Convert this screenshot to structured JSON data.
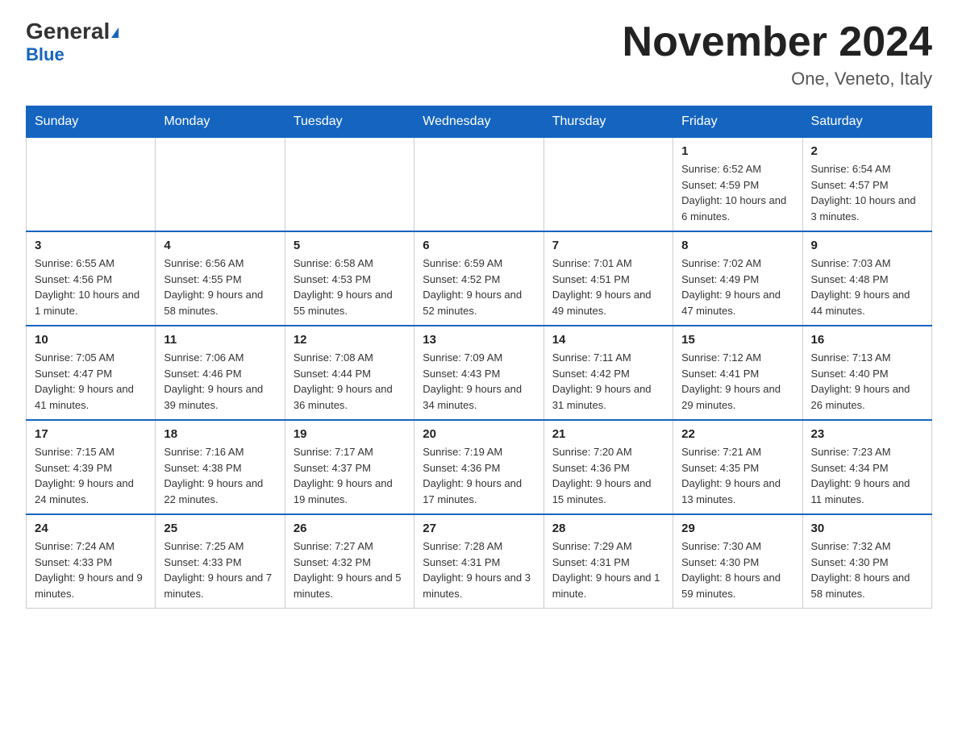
{
  "header": {
    "logo_general": "General",
    "logo_blue": "Blue",
    "month_title": "November 2024",
    "location": "One, Veneto, Italy"
  },
  "weekdays": [
    "Sunday",
    "Monday",
    "Tuesday",
    "Wednesday",
    "Thursday",
    "Friday",
    "Saturday"
  ],
  "weeks": [
    [
      {
        "day": "",
        "info": ""
      },
      {
        "day": "",
        "info": ""
      },
      {
        "day": "",
        "info": ""
      },
      {
        "day": "",
        "info": ""
      },
      {
        "day": "",
        "info": ""
      },
      {
        "day": "1",
        "info": "Sunrise: 6:52 AM\nSunset: 4:59 PM\nDaylight: 10 hours and 6 minutes."
      },
      {
        "day": "2",
        "info": "Sunrise: 6:54 AM\nSunset: 4:57 PM\nDaylight: 10 hours and 3 minutes."
      }
    ],
    [
      {
        "day": "3",
        "info": "Sunrise: 6:55 AM\nSunset: 4:56 PM\nDaylight: 10 hours and 1 minute."
      },
      {
        "day": "4",
        "info": "Sunrise: 6:56 AM\nSunset: 4:55 PM\nDaylight: 9 hours and 58 minutes."
      },
      {
        "day": "5",
        "info": "Sunrise: 6:58 AM\nSunset: 4:53 PM\nDaylight: 9 hours and 55 minutes."
      },
      {
        "day": "6",
        "info": "Sunrise: 6:59 AM\nSunset: 4:52 PM\nDaylight: 9 hours and 52 minutes."
      },
      {
        "day": "7",
        "info": "Sunrise: 7:01 AM\nSunset: 4:51 PM\nDaylight: 9 hours and 49 minutes."
      },
      {
        "day": "8",
        "info": "Sunrise: 7:02 AM\nSunset: 4:49 PM\nDaylight: 9 hours and 47 minutes."
      },
      {
        "day": "9",
        "info": "Sunrise: 7:03 AM\nSunset: 4:48 PM\nDaylight: 9 hours and 44 minutes."
      }
    ],
    [
      {
        "day": "10",
        "info": "Sunrise: 7:05 AM\nSunset: 4:47 PM\nDaylight: 9 hours and 41 minutes."
      },
      {
        "day": "11",
        "info": "Sunrise: 7:06 AM\nSunset: 4:46 PM\nDaylight: 9 hours and 39 minutes."
      },
      {
        "day": "12",
        "info": "Sunrise: 7:08 AM\nSunset: 4:44 PM\nDaylight: 9 hours and 36 minutes."
      },
      {
        "day": "13",
        "info": "Sunrise: 7:09 AM\nSunset: 4:43 PM\nDaylight: 9 hours and 34 minutes."
      },
      {
        "day": "14",
        "info": "Sunrise: 7:11 AM\nSunset: 4:42 PM\nDaylight: 9 hours and 31 minutes."
      },
      {
        "day": "15",
        "info": "Sunrise: 7:12 AM\nSunset: 4:41 PM\nDaylight: 9 hours and 29 minutes."
      },
      {
        "day": "16",
        "info": "Sunrise: 7:13 AM\nSunset: 4:40 PM\nDaylight: 9 hours and 26 minutes."
      }
    ],
    [
      {
        "day": "17",
        "info": "Sunrise: 7:15 AM\nSunset: 4:39 PM\nDaylight: 9 hours and 24 minutes."
      },
      {
        "day": "18",
        "info": "Sunrise: 7:16 AM\nSunset: 4:38 PM\nDaylight: 9 hours and 22 minutes."
      },
      {
        "day": "19",
        "info": "Sunrise: 7:17 AM\nSunset: 4:37 PM\nDaylight: 9 hours and 19 minutes."
      },
      {
        "day": "20",
        "info": "Sunrise: 7:19 AM\nSunset: 4:36 PM\nDaylight: 9 hours and 17 minutes."
      },
      {
        "day": "21",
        "info": "Sunrise: 7:20 AM\nSunset: 4:36 PM\nDaylight: 9 hours and 15 minutes."
      },
      {
        "day": "22",
        "info": "Sunrise: 7:21 AM\nSunset: 4:35 PM\nDaylight: 9 hours and 13 minutes."
      },
      {
        "day": "23",
        "info": "Sunrise: 7:23 AM\nSunset: 4:34 PM\nDaylight: 9 hours and 11 minutes."
      }
    ],
    [
      {
        "day": "24",
        "info": "Sunrise: 7:24 AM\nSunset: 4:33 PM\nDaylight: 9 hours and 9 minutes."
      },
      {
        "day": "25",
        "info": "Sunrise: 7:25 AM\nSunset: 4:33 PM\nDaylight: 9 hours and 7 minutes."
      },
      {
        "day": "26",
        "info": "Sunrise: 7:27 AM\nSunset: 4:32 PM\nDaylight: 9 hours and 5 minutes."
      },
      {
        "day": "27",
        "info": "Sunrise: 7:28 AM\nSunset: 4:31 PM\nDaylight: 9 hours and 3 minutes."
      },
      {
        "day": "28",
        "info": "Sunrise: 7:29 AM\nSunset: 4:31 PM\nDaylight: 9 hours and 1 minute."
      },
      {
        "day": "29",
        "info": "Sunrise: 7:30 AM\nSunset: 4:30 PM\nDaylight: 8 hours and 59 minutes."
      },
      {
        "day": "30",
        "info": "Sunrise: 7:32 AM\nSunset: 4:30 PM\nDaylight: 8 hours and 58 minutes."
      }
    ]
  ]
}
